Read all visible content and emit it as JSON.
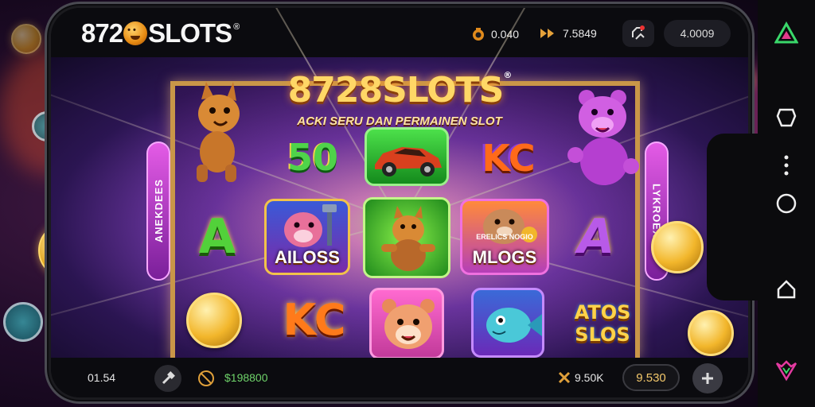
{
  "header": {
    "logo": {
      "prefix": "872",
      "suffix": "SLOTS",
      "reg": "®"
    },
    "coins_value": "0.040",
    "boost_value": "7.5849",
    "balance_value": "4.0009"
  },
  "game": {
    "title": "8728SLOTS",
    "title_reg": "®",
    "subtitle": "ACKI SERU DAN PERMAINEN SLOT",
    "left_banner": "ANEKDEES",
    "right_banner": "LYKROEX",
    "symbols": {
      "top_left_animal": "cat",
      "fifty": "50",
      "car": "car",
      "kc_top": "KC",
      "purple_bear": "bear",
      "letter_a": "A",
      "tile_ailoss": "AILOSS",
      "tile_green": "fox",
      "tile_mlogs": "MLOGS",
      "tile_mlogs_small": "ERELICS NOGIO",
      "letter_a2": "A",
      "kc_bottom": "KC",
      "hamster": "hamster",
      "fish": "fish",
      "atos_slots_top": "ATOS",
      "atos_slots_bottom": "SLOS"
    }
  },
  "footer": {
    "time": "01.54",
    "win_value": "$198800",
    "multiplier": "9.50K",
    "bet_value": "9.530"
  },
  "colors": {
    "accent_gold": "#f2b62b",
    "win_green": "#6fd36a",
    "banner_magenta": "#e45be6"
  }
}
